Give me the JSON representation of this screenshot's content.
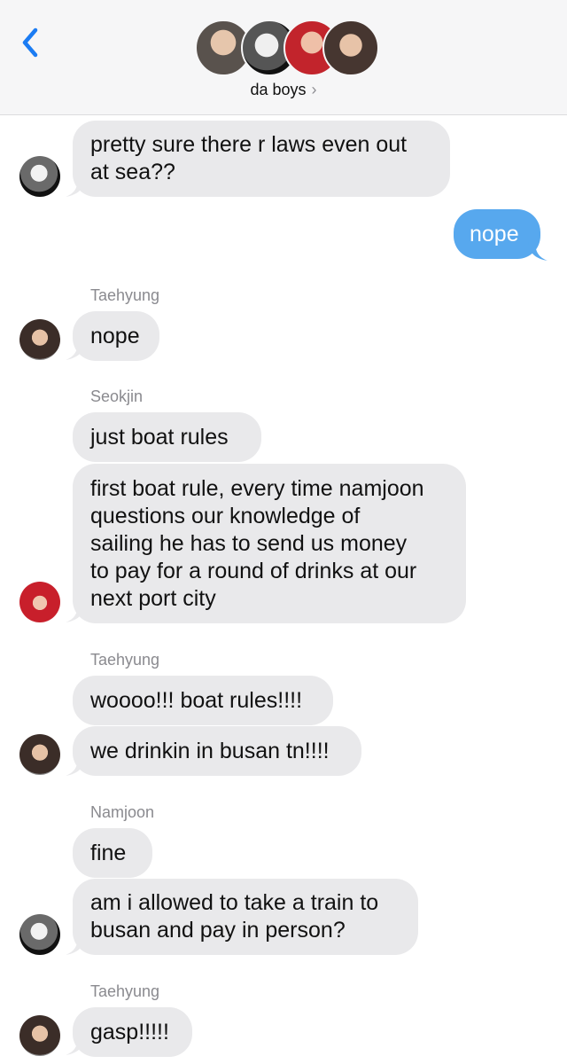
{
  "header": {
    "group_name": "da boys",
    "chevron": "›",
    "back_icon": "chevron-left-icon",
    "accent_color": "#1b7cf3"
  },
  "messages": [
    {
      "sender": "",
      "text_lines": [
        "pretty sure there r laws even out",
        "at sea??"
      ],
      "direction": "in"
    },
    {
      "sender": "",
      "text": "nope",
      "direction": "out"
    },
    {
      "sender": "Taehyung",
      "text": "nope",
      "direction": "in"
    },
    {
      "sender": "Seokjin",
      "text": "just boat rules",
      "direction": "in"
    },
    {
      "sender": "",
      "text_lines": [
        "first boat rule, every time namjoon",
        "questions our knowledge of",
        "sailing he has to send us money",
        "to pay for a round of drinks at our",
        "next port city"
      ],
      "direction": "in"
    },
    {
      "sender": "Taehyung",
      "text": "woooo!!! boat rules!!!!",
      "direction": "in"
    },
    {
      "sender": "",
      "text": "we drinkin in busan tn!!!!",
      "direction": "in"
    },
    {
      "sender": "Namjoon",
      "text": "fine",
      "direction": "in"
    },
    {
      "sender": "",
      "text_lines": [
        "am i allowed to take a train to",
        "busan and pay in person?"
      ],
      "direction": "in"
    },
    {
      "sender": "Taehyung",
      "text": "gasp!!!!!",
      "direction": "in"
    }
  ],
  "colors": {
    "incoming_bubble": "#e9e9eb",
    "outgoing_bubble": "#57a8ee"
  }
}
